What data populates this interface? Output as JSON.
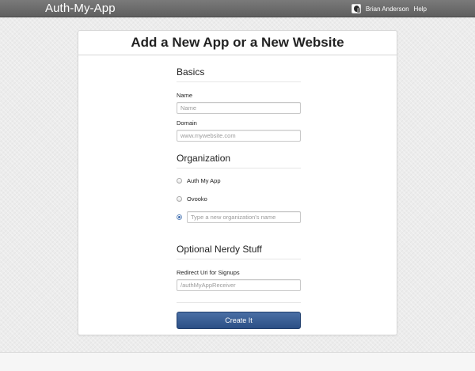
{
  "navbar": {
    "brand": "Auth-My-App",
    "user_name": "Brian Anderson",
    "help_label": "Help"
  },
  "page": {
    "title": "Add a New App or a New Website"
  },
  "basics": {
    "heading": "Basics",
    "name_label": "Name",
    "name_placeholder": "Name",
    "domain_label": "Domain",
    "domain_placeholder": "www.mywebsite.com"
  },
  "organization": {
    "heading": "Organization",
    "options": [
      {
        "label": "Auth My App",
        "selected": false
      },
      {
        "label": "Ovooko",
        "selected": false
      }
    ],
    "new_org_placeholder": "Type a new organization's name",
    "new_org_selected": true
  },
  "nerdy": {
    "heading": "Optional Nerdy Stuff",
    "redirect_label": "Redirect Uri for Signups",
    "redirect_placeholder": "/authMyAppReceiver"
  },
  "actions": {
    "submit_label": "Create It"
  },
  "colors": {
    "navbar": "#6b6b6b",
    "primary_button": "#2f5489",
    "radio_selected": "#3d6bb0"
  }
}
